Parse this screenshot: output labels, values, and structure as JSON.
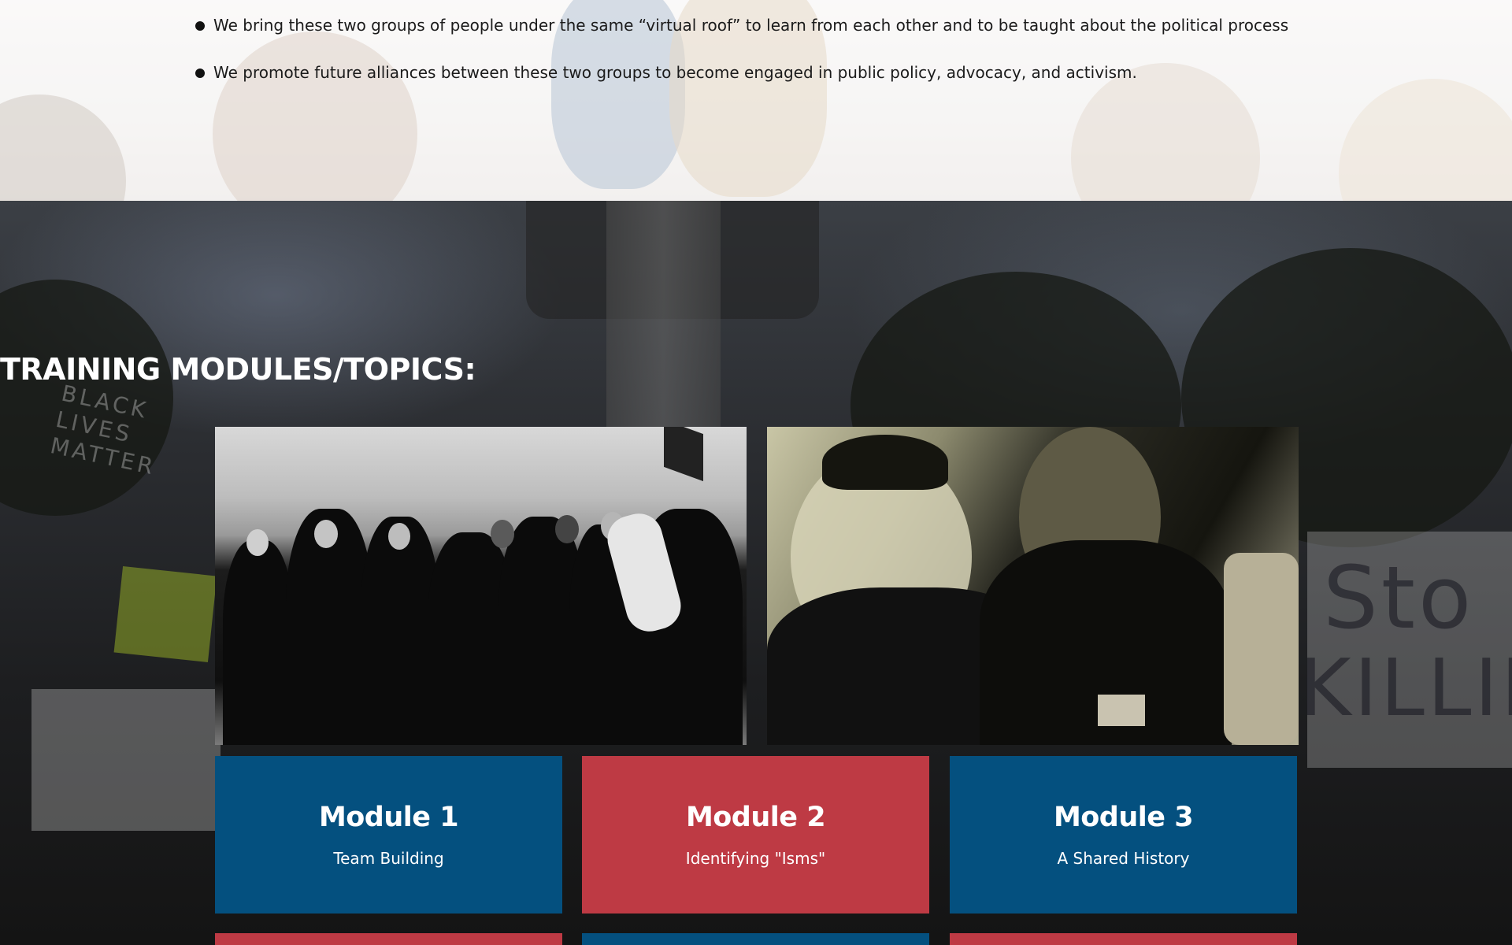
{
  "intro": {
    "bullets": [
      "We bring these two groups of people under the same “virtual roof” to learn from each other and to be taught about the political process",
      "We promote future alliances between these two groups to become engaged in public policy, advocacy, and activism."
    ]
  },
  "training": {
    "heading": "TRAINING MODULES/TOPICS:",
    "modules": [
      {
        "title": "Module 1",
        "subtitle": "Team Building",
        "color": "#04507f"
      },
      {
        "title": "Module 2",
        "subtitle": "Identifying \"Isms\"",
        "color": "#be3a44"
      },
      {
        "title": "Module 3",
        "subtitle": "A Shared History",
        "color": "#04507f"
      }
    ],
    "next_row_colors": [
      "#be3a44",
      "#04507f",
      "#be3a44"
    ]
  },
  "background_signs": {
    "left_sign": "BLACK LIVES MATTER",
    "right_sign_line1": "Sto",
    "right_sign_line2": "KILLIN"
  },
  "colors": {
    "module_blue": "#04507f",
    "module_red": "#be3a44",
    "heading_text": "#ffffff",
    "body_text": "#1b1b1b"
  },
  "icons": {
    "bullet": "filled-circle"
  }
}
